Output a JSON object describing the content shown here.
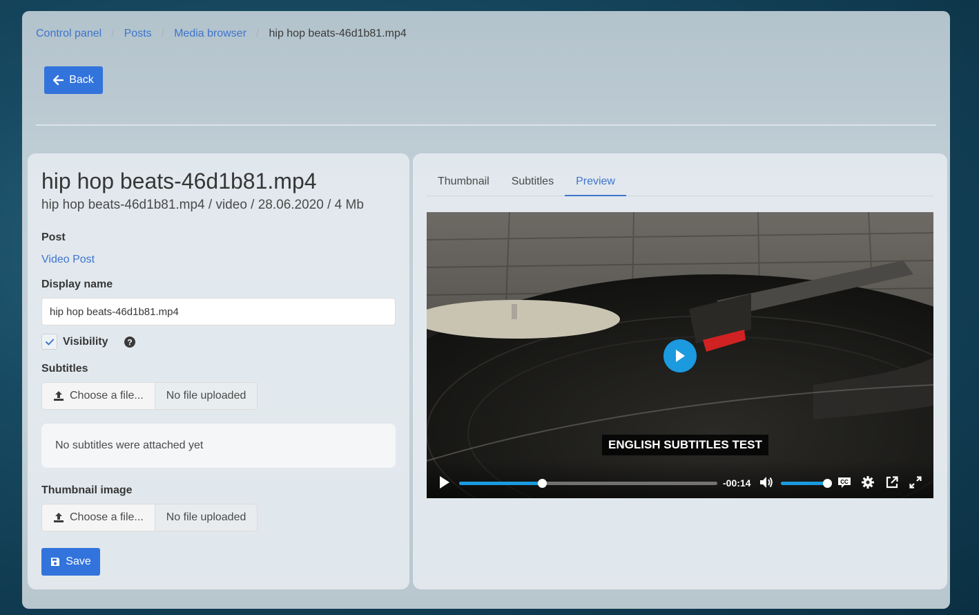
{
  "breadcrumb": {
    "items": [
      "Control panel",
      "Posts",
      "Media browser"
    ],
    "current": "hip hop beats-46d1b81.mp4"
  },
  "back_button": {
    "label": "Back",
    "icon": "arrow-left-icon"
  },
  "media": {
    "title": "hip hop beats-46d1b81.mp4",
    "meta": "hip hop beats-46d1b81.mp4 / video / 28.06.2020 / 4 Mb"
  },
  "form": {
    "post_label": "Post",
    "post_link": "Video Post",
    "display_name_label": "Display name",
    "display_name_value": "hip hop beats-46d1b81.mp4",
    "visibility_label": "Visibility",
    "visibility_checked": true,
    "subtitles_label": "Subtitles",
    "choose_file_label": "Choose a file...",
    "no_file_label": "No file uploaded",
    "no_subtitles_text": "No subtitles were attached yet",
    "thumbnail_label": "Thumbnail image",
    "save_label": "Save"
  },
  "tabs": [
    "Thumbnail",
    "Subtitles",
    "Preview"
  ],
  "active_tab": "Preview",
  "player": {
    "subtitle_text": "ENGLISH SUBTITLES TEST",
    "time_remaining": "-00:14",
    "progress_fraction": 0.32,
    "volume_fraction": 1.0,
    "accent_color": "#1b9ae0"
  },
  "colors": {
    "primary": "#3273dc",
    "link": "#3e74cc"
  }
}
